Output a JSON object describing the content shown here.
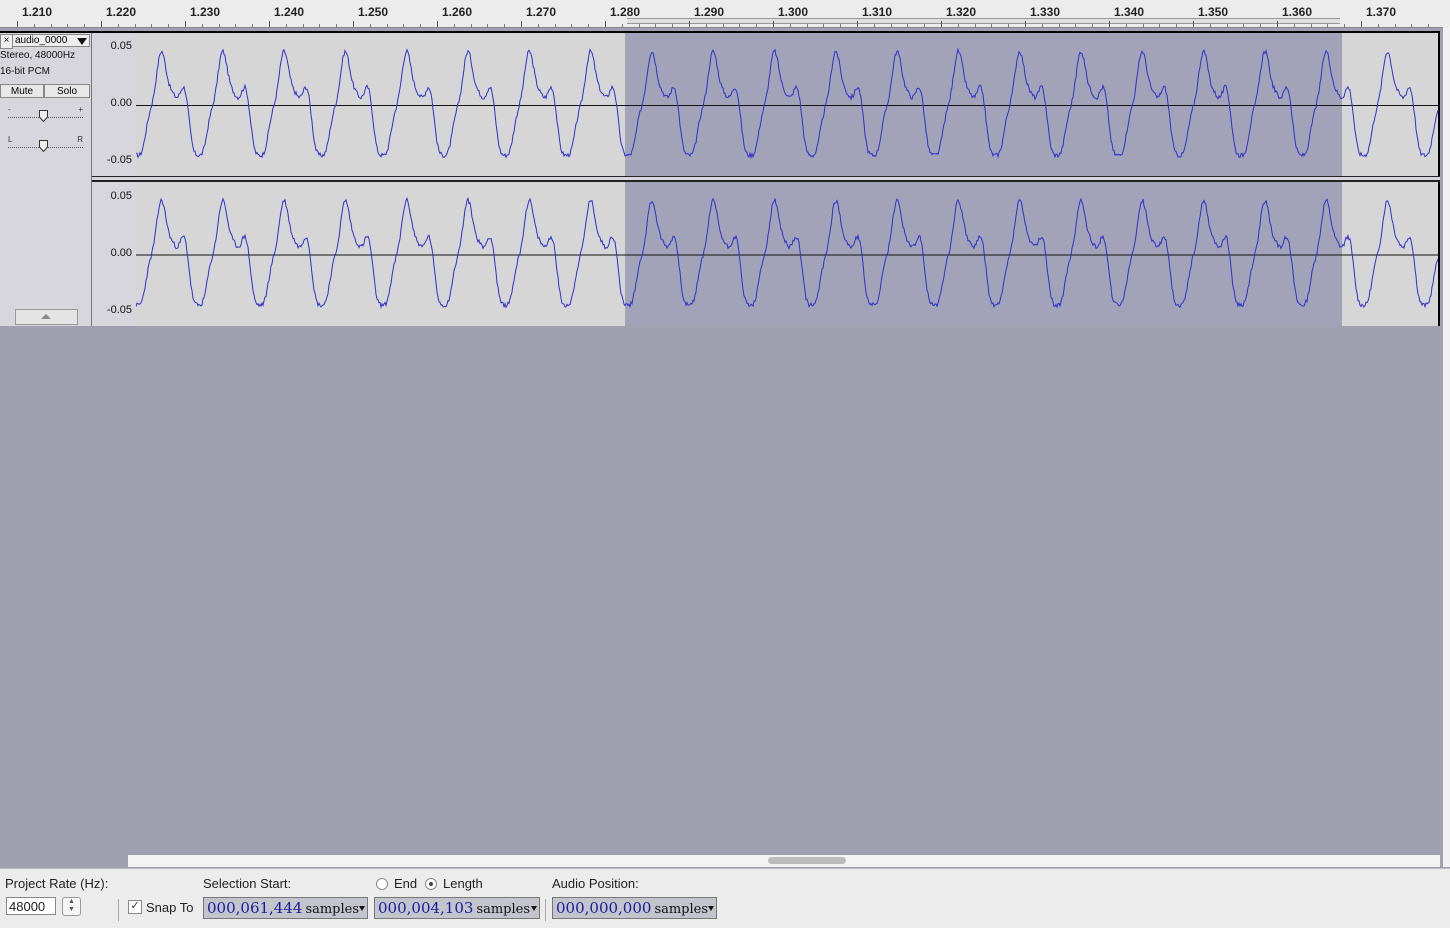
{
  "ruler": {
    "ticks": [
      "1.210",
      "1.220",
      "1.230",
      "1.240",
      "1.250",
      "1.260",
      "1.270",
      "1.280",
      "1.290",
      "1.300",
      "1.310",
      "1.320",
      "1.330",
      "1.340",
      "1.350",
      "1.360",
      "1.370"
    ]
  },
  "track": {
    "close_label": "×",
    "name": "audio_0000",
    "info_line1": "Stereo, 48000Hz",
    "info_line2": "16-bit PCM",
    "mute_label": "Mute",
    "solo_label": "Solo",
    "gain_minus": "-",
    "gain_plus": "+",
    "pan_left": "L",
    "pan_right": "R",
    "channel_scale": [
      "0.05",
      "0.00",
      "-0.05"
    ]
  },
  "statusbar": {
    "project_rate_label": "Project Rate (Hz):",
    "project_rate_value": "48000",
    "snap_to_label": "Snap To",
    "snap_to_checked": "✓",
    "selection_start_label": "Selection Start:",
    "end_label": "End",
    "length_label": "Length",
    "audio_position_label": "Audio Position:",
    "selection_start_value": "000,061,444",
    "selection_length_value": "000,004,103",
    "audio_position_value": "000,000,000",
    "unit": "samples"
  },
  "colors": {
    "waveform": "#3030cc",
    "selection_bg": "#a2a2b8",
    "unselected_bg": "#d6d6d6",
    "empty_bg": "#a0a0b0"
  }
}
